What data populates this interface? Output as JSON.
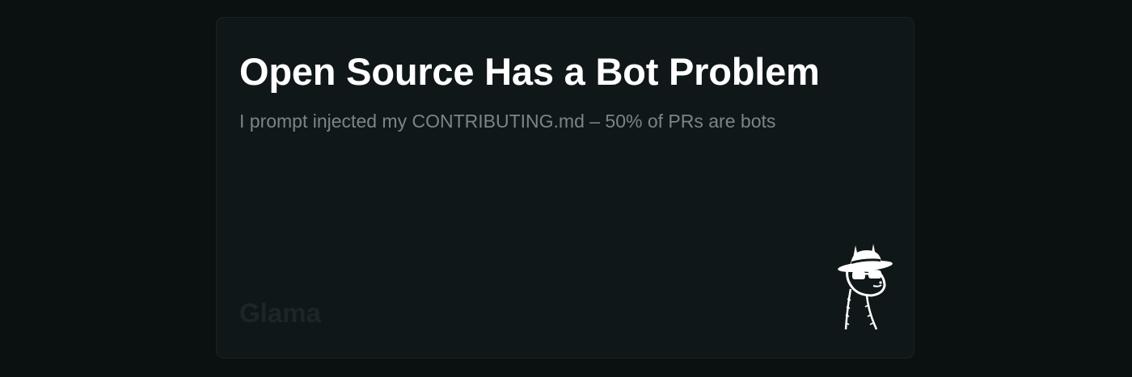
{
  "card": {
    "title": "Open Source Has a Bot Problem",
    "subtitle": "I prompt injected my CONTRIBUTING.md – 50% of PRs are bots",
    "brand": "Glama",
    "mascot_icon": "llama-with-hat-and-sunglasses-icon"
  },
  "colors": {
    "page_background": "#0b1011",
    "card_background": "#101718",
    "title": "#ffffff",
    "subtitle": "#7b8586",
    "brand": "#1d2526"
  }
}
